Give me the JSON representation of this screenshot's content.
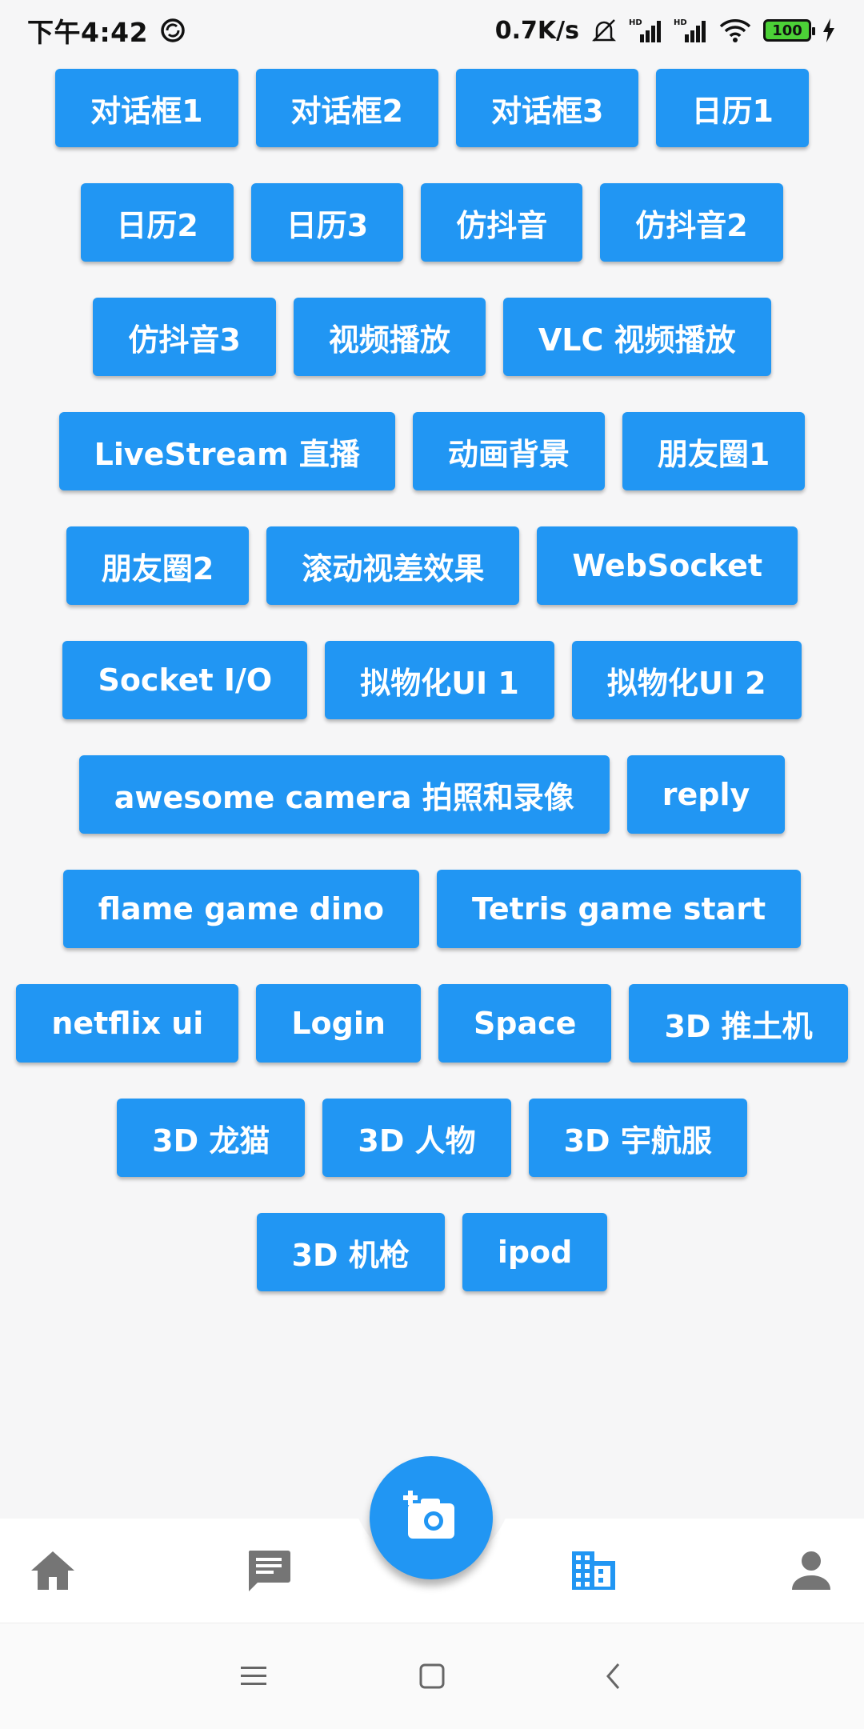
{
  "status_bar": {
    "time": "下午4:42",
    "network_speed": "0.7K/s",
    "battery": "100",
    "icons": [
      "sync-icon",
      "mute-icon",
      "signal-hd-icon",
      "signal-hd-icon",
      "wifi-icon",
      "battery-icon",
      "charging-icon"
    ]
  },
  "buttons": [
    [
      "对话框1",
      "对话框2",
      "对话框3",
      "日历1"
    ],
    [
      "日历2",
      "日历3",
      "仿抖音",
      "仿抖音2"
    ],
    [
      "仿抖音3",
      "视频播放",
      "VLC 视频播放"
    ],
    [
      "LiveStream 直播",
      "动画背景",
      "朋友圈1"
    ],
    [
      "朋友圈2",
      "滚动视差效果",
      "WebSocket"
    ],
    [
      "Socket I/O",
      "拟物化UI 1",
      "拟物化UI 2"
    ],
    [
      "awesome camera 拍照和录像",
      "reply"
    ],
    [
      "flame game dino",
      "Tetris game start"
    ],
    [
      "netflix ui",
      "Login",
      "Space",
      "3D 推土机"
    ],
    [
      "3D 龙猫",
      "3D 人物",
      "3D 宇航服"
    ],
    [
      "3D 机枪",
      "ipod"
    ]
  ],
  "bottom_nav": {
    "items": [
      {
        "icon": "home-icon",
        "active": false
      },
      {
        "icon": "message-icon",
        "active": false
      },
      {
        "icon": "add-photo-icon",
        "active": false
      },
      {
        "icon": "business-icon",
        "active": true
      },
      {
        "icon": "person-icon",
        "active": false
      }
    ]
  },
  "system_nav": {
    "icons": [
      "menu-icon",
      "home-square-icon",
      "back-icon"
    ]
  },
  "colors": {
    "accent": "#2196f3",
    "inactive_icon": "#757575",
    "background": "#f6f6f7"
  }
}
